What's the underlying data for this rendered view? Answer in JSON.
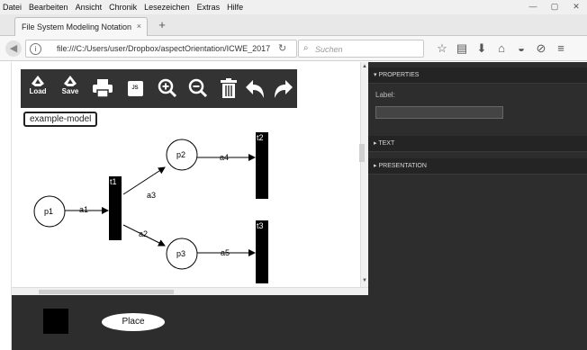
{
  "menu": [
    "Datei",
    "Bearbeiten",
    "Ansicht",
    "Chronik",
    "Lesezeichen",
    "Extras",
    "Hilfe"
  ],
  "tab": {
    "title": "File System Modeling Notation",
    "close": "×",
    "new": "+"
  },
  "nav": {
    "url": "file:///C:/Users/user/Dropbox/aspectOrientation/ICWE_2017",
    "search_placeholder": "Suchen"
  },
  "toolbar": {
    "load_label": "Load",
    "save_label": "Save",
    "js_label": "JS"
  },
  "model_name": "example-model",
  "diagram": {
    "places": [
      "p1",
      "p2",
      "p3"
    ],
    "transitions": [
      "t1",
      "t2",
      "t3"
    ],
    "arcs": [
      "a1",
      "a2",
      "a3",
      "a4",
      "a5"
    ]
  },
  "properties": {
    "section_properties": "PROPERTIES",
    "label_caption": "Label:",
    "label_value": "",
    "section_text": "TEXT",
    "section_presentation": "PRESENTATION"
  },
  "palette": {
    "place_label": "Place"
  },
  "colors": {
    "toolbar_bg": "#333333",
    "panel_bg": "#2d2d2d",
    "accent": "#000000"
  }
}
